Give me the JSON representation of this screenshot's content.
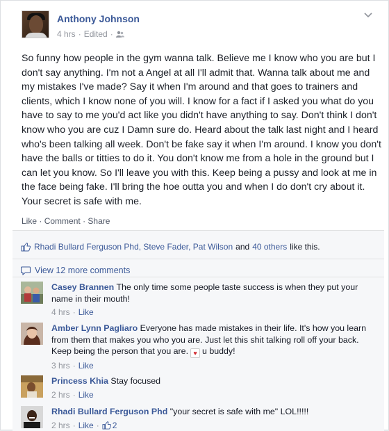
{
  "post": {
    "author": "Anthony Johnson",
    "time": "4 hrs",
    "sep": "·",
    "edited": "Edited",
    "sep2": "·",
    "text": "So funny how people in the gym wanna talk. Believe me I know who you are but I don't say anything. I'm not a Angel at all I'll admit that. Wanna talk about me and my mistakes I've made? Say it when I'm around and that goes to trainers and clients, which I know none of you will. I know for a fact if I asked you what do you have to say to me you'd act like you didn't have anything to say. Don't think I don't know who you are cuz I Damn sure do. Heard about the talk last night and I heard who's been talking all week. Don't be fake say it when I'm around. I know you don't have the balls or titties to do it. You don't know me from a hole in the ground but I can let you know. So I'll leave you with this. Keep being a pussy and look at me in the face being fake. I'll bring the hoe outta you and when I do don't cry about it. Your secret is safe with me."
  },
  "actions": {
    "like": "Like",
    "comment": "Comment",
    "share": "Share",
    "dot": "·"
  },
  "likes": {
    "names": "Rhadi Bullard Ferguson Phd, Steve Fader, Pat Wilson",
    "and": "and",
    "others": "40 others",
    "suffix": "like this."
  },
  "view_more": "View 12 more comments",
  "comments": [
    {
      "name": "Casey Brannen",
      "text": "The only time some people taste success is when they put your name in their mouth!",
      "time": "4 hrs",
      "like": "Like"
    },
    {
      "name": "Amber Lynn Pagliaro",
      "text_a": "Everyone has made mistakes in their life. It's how you learn from them that makes you who you are. Just let this shit talking roll off your back. Keep being the person that you are.",
      "text_b": "u buddy!",
      "time": "3 hrs",
      "like": "Like"
    },
    {
      "name": "Princess Khia",
      "text": "Stay focused",
      "time": "2 hrs",
      "like": "Like"
    },
    {
      "name": "Rhadi Bullard Ferguson Phd",
      "text": "\"your secret is safe with me\" LOL!!!!!",
      "time": "2 hrs",
      "like": "Like",
      "like_count": "2"
    }
  ],
  "colors": {
    "link": "#3b5998",
    "meta": "#90949c",
    "ufi_bg": "#f6f7f9"
  },
  "icons": [
    "friends-icon",
    "chevron-down-icon",
    "thumbs-up-icon",
    "comment-bubble-icon",
    "heart-icon"
  ]
}
